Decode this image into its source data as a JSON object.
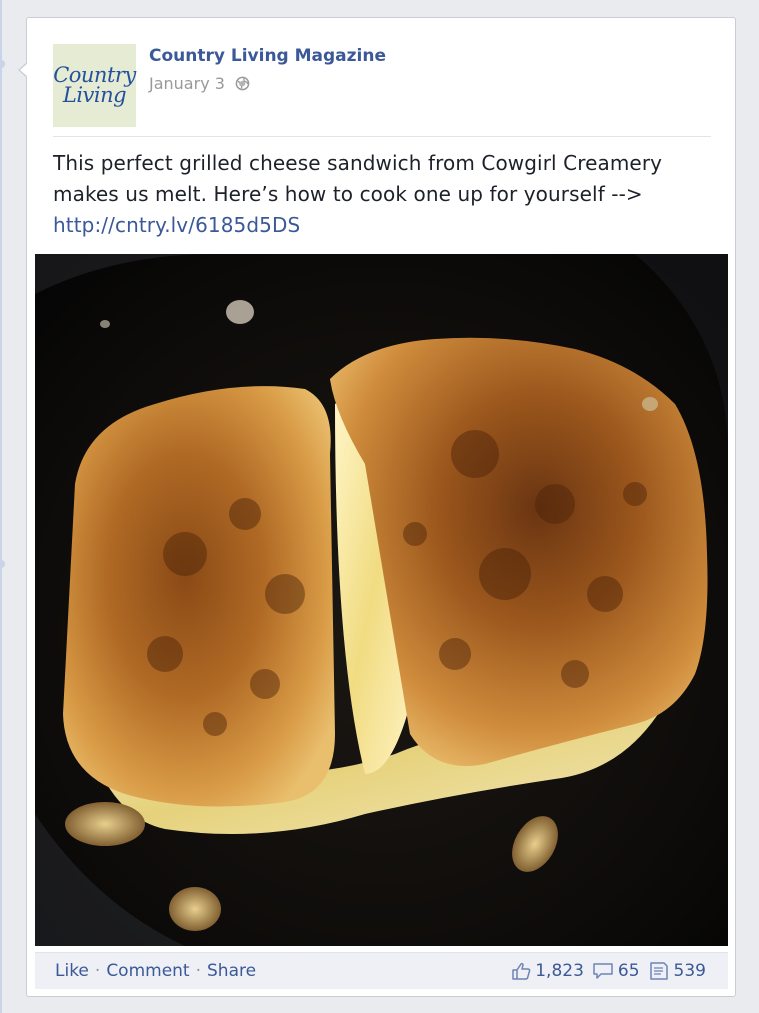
{
  "post": {
    "author": "Country Living Magazine",
    "date": "January 3",
    "avatar_text": [
      "Country",
      "Living"
    ],
    "text_prefix": "This perfect grilled cheese sandwich from Cowgirl Creamery makes us melt. Here’s how to cook one up for yourself --> ",
    "link_text": "http://cntry.lv/6185d5DS",
    "photo_icon": "grilled-cheese-photo"
  },
  "footer": {
    "like_label": "Like",
    "comment_label": "Comment",
    "share_label": "Share",
    "separator": "·",
    "likes_count": "1,823",
    "comments_count": "65",
    "shares_count": "539"
  },
  "icons": {
    "privacy": "globe-icon",
    "likes": "thumbs-up-icon",
    "comments": "comment-bubble-icon",
    "shares": "share-icon"
  },
  "colors": {
    "link": "#3b5998",
    "meta": "#999999",
    "footer_bg": "#eef0f5",
    "logo": "#24509e"
  }
}
